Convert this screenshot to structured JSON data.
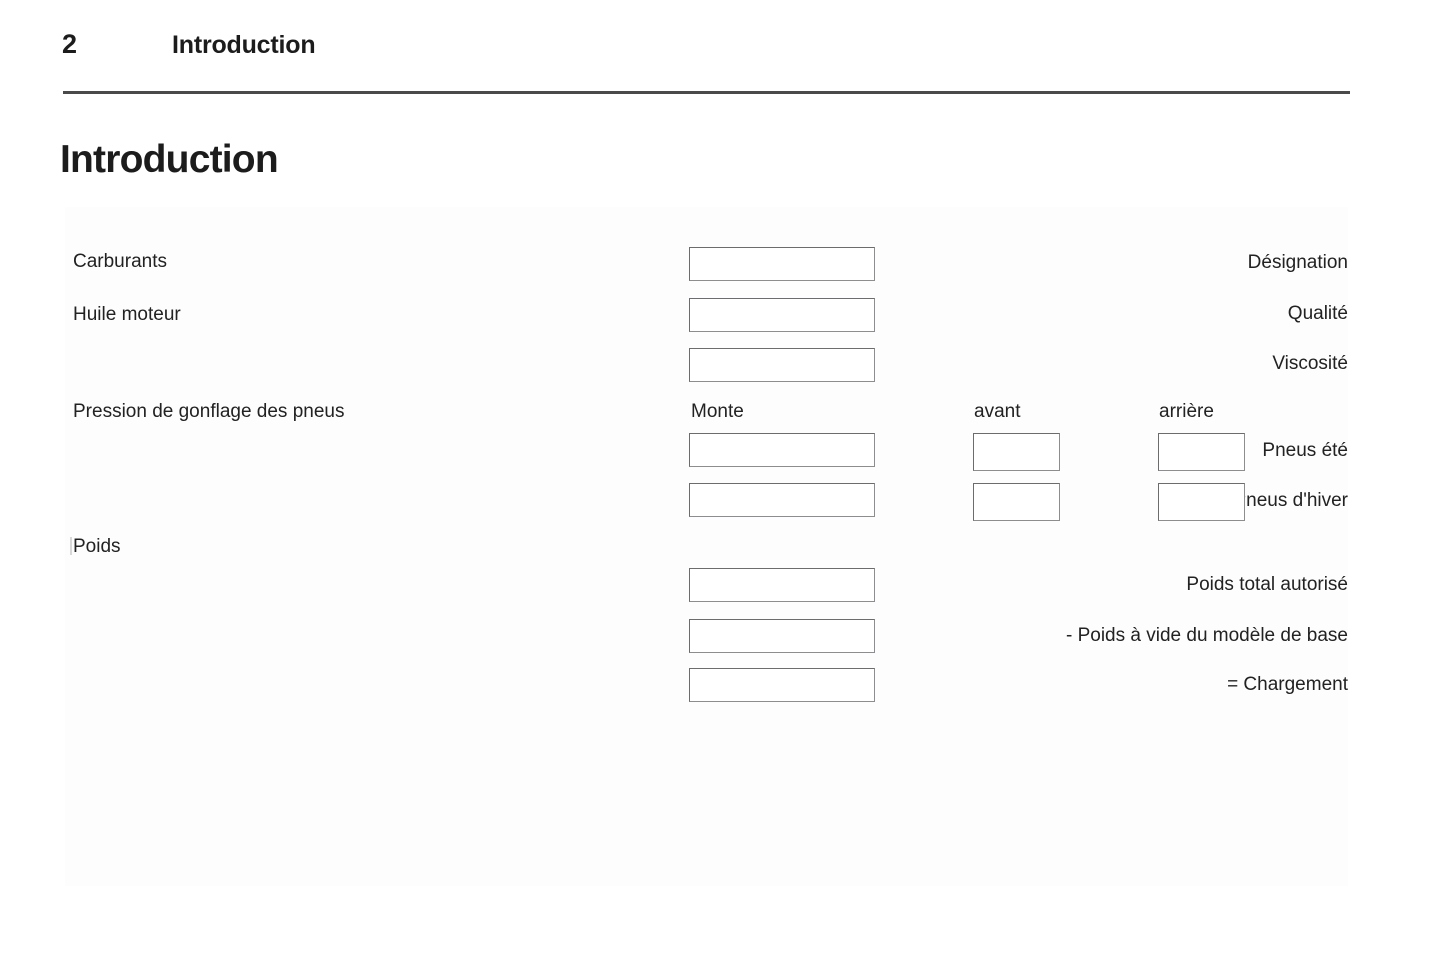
{
  "header": {
    "page_number": "2",
    "chapter": "Introduction"
  },
  "section": {
    "title": "Introduction"
  },
  "form": {
    "groups": [
      {
        "label": "Carburants"
      },
      {
        "label": "Huile moteur"
      },
      {
        "label": "Pression de gonflage des pneus"
      },
      {
        "label": "Poids"
      }
    ],
    "column_headers": {
      "monte": "Monte",
      "avant": "avant",
      "arriere": "arrière"
    },
    "fields": [
      {
        "label": "Désignation",
        "value": ""
      },
      {
        "label": "Qualité",
        "value": ""
      },
      {
        "label": "Viscosité",
        "value": ""
      },
      {
        "label": "Pneus été",
        "value": "",
        "avant": "",
        "arriere": ""
      },
      {
        "label": "Pneus d'hiver",
        "value": "",
        "avant": "",
        "arriere": ""
      },
      {
        "label": "Poids total autorisé",
        "value": ""
      },
      {
        "label": "- Poids à vide du modèle de base",
        "value": ""
      },
      {
        "label": "= Chargement",
        "value": ""
      }
    ]
  },
  "colors": {
    "text": "#1c1c1c",
    "rule": "#4a4a4d",
    "panel_background": "#fdfdfd",
    "box_border": "#6c6c6e",
    "box_fill": "#ffffff"
  }
}
